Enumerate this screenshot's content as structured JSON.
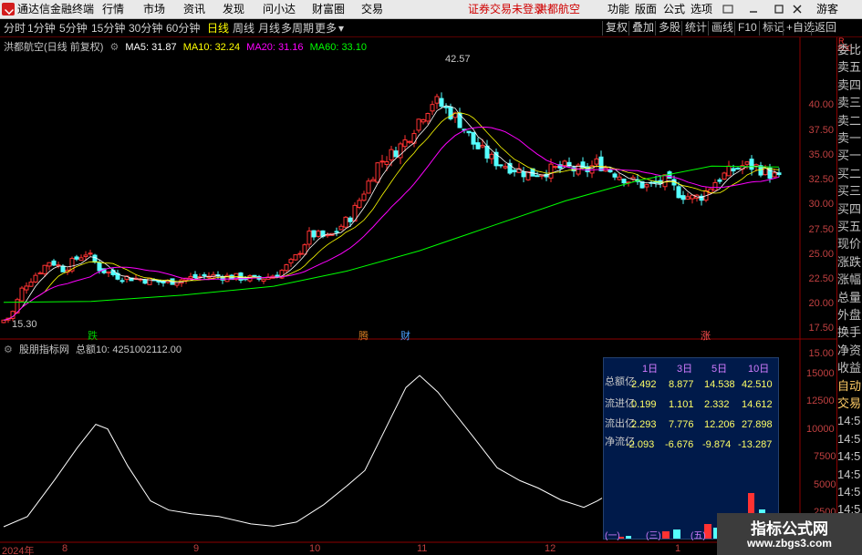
{
  "app": {
    "title": "通达信金融终端",
    "menu": [
      "行情",
      "市场",
      "资讯",
      "发现",
      "问小达",
      "财富圈",
      "交易"
    ],
    "status_text": "证券交易未登录",
    "stock_name": "洪都航空",
    "right_menu": [
      "功能",
      "版面",
      "公式",
      "选项"
    ],
    "user": "游客"
  },
  "toolbar": {
    "periods": [
      "分时",
      "1分钟",
      "5分钟",
      "15分钟",
      "30分钟",
      "60分钟",
      "日线",
      "周线",
      "月线",
      "多周期",
      "更多"
    ],
    "active_period": "日线",
    "right": [
      "复权",
      "叠加",
      "多股",
      "统计",
      "画线",
      "F10",
      "+自选",
      "返回"
    ],
    "mark_label": "标记"
  },
  "main_chart": {
    "header_name": "洪都航空(日线 前复权)",
    "ma5": "MA5: 31.87",
    "ma10": "MA10: 32.24",
    "ma20": "MA20: 31.16",
    "ma60": "MA60: 33.10",
    "high_label": "42.57",
    "low_label": "15.30",
    "y_axis": [
      "40.00",
      "37.50",
      "35.00",
      "32.50",
      "30.00",
      "27.50",
      "25.00",
      "22.50",
      "20.00",
      "17.50",
      "15.00"
    ],
    "markers": [
      "跌",
      "腾",
      "财",
      "涨"
    ],
    "colors": {
      "up": "#ff3232",
      "down": "#54ffff",
      "ma5": "#ffffff",
      "ma10": "#ffff00",
      "ma20": "#ff00ff",
      "ma60": "#00ff00"
    }
  },
  "sub_chart": {
    "header_name": "股朋指标网",
    "total_label": "总额10: 4251002112.00",
    "y_axis": [
      "15000",
      "12500",
      "10000",
      "7500",
      "5000",
      "2500"
    ]
  },
  "date_axis": [
    "2024年",
    "8",
    "9",
    "10",
    "11",
    "12",
    "1"
  ],
  "fund_table": {
    "headers": [
      "1日",
      "3日",
      "5日",
      "10日"
    ],
    "rows": [
      {
        "label": "总额亿",
        "color": "#ff3232",
        "values": [
          "2.492",
          "8.877",
          "14.538",
          "42.510"
        ]
      },
      {
        "label": "流进亿",
        "color": "#ff33ff",
        "values": [
          "0.199",
          "1.101",
          "2.332",
          "14.612"
        ]
      },
      {
        "label": "流出亿",
        "color": "#33ffff",
        "values": [
          "2.293",
          "7.776",
          "12.206",
          "27.898"
        ]
      },
      {
        "label": "净流亿",
        "color": "#ffcc00",
        "values": [
          "-2.093",
          "-6.676",
          "-9.874",
          "-13.287"
        ]
      }
    ],
    "bar_labels": [
      "(一)",
      "(三)",
      "(五)"
    ]
  },
  "sidebar_labels": [
    "委比",
    "卖五",
    "卖四",
    "卖三",
    "卖二",
    "卖一",
    "买一",
    "买二",
    "买三",
    "买四",
    "买五",
    "现价",
    "涨跌",
    "涨幅",
    "总量",
    "外盘",
    "换手",
    "净资",
    "收益",
    "自动",
    "交易",
    "14:5",
    "14:5",
    "14:5",
    "14:5",
    "14:5",
    "14:5",
    "14:5",
    "14:5"
  ],
  "side_scale": [
    "R",
    "500"
  ],
  "watermark": {
    "line1": "指标公式网",
    "line2": "www.zbgs3.com"
  }
}
